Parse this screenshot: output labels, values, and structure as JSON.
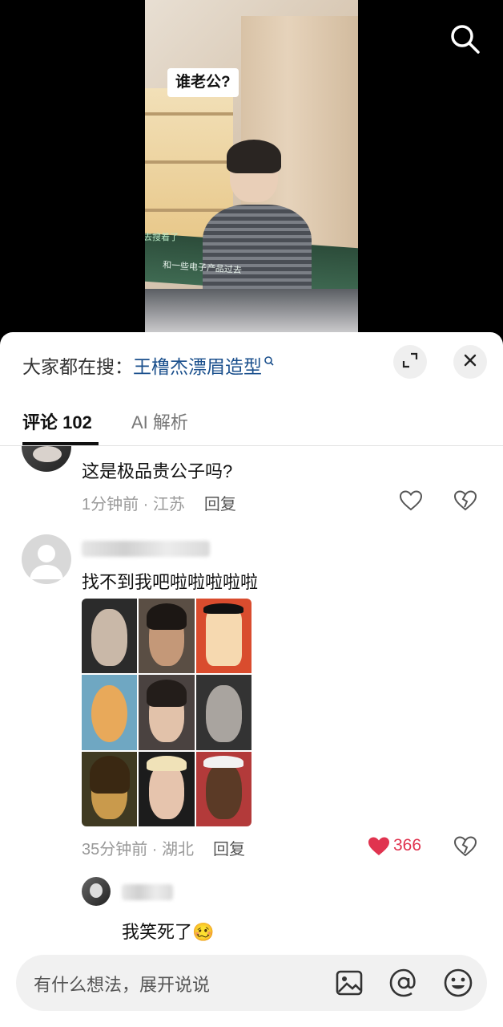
{
  "video": {
    "caption_bubble": "谁老公?",
    "subtitle_bottom": "和一些电子产品过去",
    "subtitle_side": "去搜着了"
  },
  "search_bar": {
    "prefix": "大家都在搜：",
    "query": "王橹杰漂眉造型"
  },
  "tabs": [
    {
      "label": "评论 102",
      "active": true
    },
    {
      "label": "AI 解析",
      "active": false
    }
  ],
  "comments": [
    {
      "text": "这是极品贵公子吗?",
      "time": "1分钟前",
      "location": "江苏",
      "reply_label": "回复"
    },
    {
      "text": "找不到我吧啦啦啦啦啦",
      "time": "35分钟前",
      "location": "湖北",
      "reply_label": "回复",
      "likes": "366"
    }
  ],
  "sub_reply": {
    "text": "我笑死了",
    "emoji": "🥴"
  },
  "input": {
    "placeholder": "有什么想法，展开说说"
  },
  "colors": {
    "link": "#1a4f8c",
    "like": "#e0334f"
  }
}
